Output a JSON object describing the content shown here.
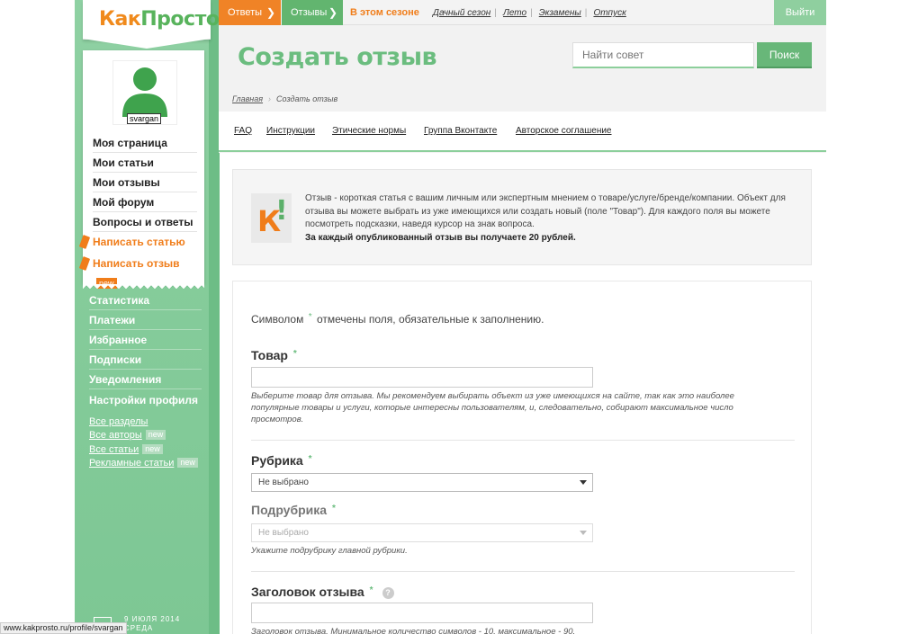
{
  "logo": {
    "part1": "Как",
    "part2": "Просто!",
    "letter_k": "К"
  },
  "profile": {
    "username": "svargan",
    "menu": [
      "Моя страница",
      "Мои статьи",
      "Мои отзывы",
      "Мой форум",
      "Вопросы и ответы"
    ],
    "write_article": "Написать статью",
    "write_review": "Написать отзыв",
    "new_badge": "new"
  },
  "sidebar": {
    "menu": [
      "Статистика",
      "Платежи",
      "Избранное",
      "Подписки",
      "Уведомления",
      "Настройки профиля"
    ],
    "links": [
      {
        "label": "Все разделы",
        "badge": ""
      },
      {
        "label": "Все авторы",
        "badge": "new"
      },
      {
        "label": "Все статьи",
        "badge": "new"
      },
      {
        "label": "Рекламные статьи",
        "badge": "new"
      }
    ],
    "date_line1": "9 июля 2014",
    "date_line2": "среда"
  },
  "topbar": {
    "tab_answers": "Ответы",
    "tab_reviews": "Отзывы",
    "arrow": "❯",
    "season_label": "В этом сезоне",
    "season_links": [
      "Дачный сезон",
      "Лето",
      "Экзамены",
      "Отпуск"
    ],
    "logout": "Выйти"
  },
  "header": {
    "title": "Создать отзыв",
    "search_placeholder": "Найти совет",
    "search_button": "Поиск",
    "breadcrumb_home": "Главная",
    "breadcrumb_current": "Создать отзыв",
    "links": [
      "FAQ",
      "Инструкции",
      "Этические нормы",
      "Группа Вконтакте",
      "Авторское соглашение"
    ]
  },
  "info": {
    "text": "Отзыв - короткая статья с вашим личным или экспертным мнением о товаре/услуге/бренде/компании. Объект для отзыва вы можете выбрать из уже имеющихся или создать новый (поле \"Товар\"). Для каждого поля вы можете посмотреть подсказки, наведя курсор на знак вопроса.",
    "bold": "За каждый опубликованный отзыв вы получаете 20 рублей."
  },
  "form": {
    "note_before": "Символом",
    "note_after": "отмечены поля, обязательные к заполнению.",
    "star": "*",
    "product_label": "Товар",
    "product_hint": "Выберите товар для отзыва. Мы рекомендуем выбирать объект из уже имеющихся на сайте, так как это наиболее популярные товары и услуги, которые интересны пользователям, и, следовательно, собирают максимальное число просмотров.",
    "rubric_label": "Рубрика",
    "rubric_value": "Не выбрано",
    "subrubric_label": "Подрубрика",
    "subrubric_value": "Не выбрано",
    "subrubric_hint": "Укажите подрубрику главной рубрики.",
    "title_label": "Заголовок отзыва",
    "help": "?",
    "title_hint": "Заголовок отзыва. Минимальное количество символов - 10, максимальное - 90."
  },
  "statusbar": {
    "url": "www.kakprosto.ru/profile/svargan"
  },
  "colors": {
    "accent_green": "#6bbd7f",
    "accent_orange": "#f07d1a",
    "sidebar_green": "#86cc9b"
  }
}
